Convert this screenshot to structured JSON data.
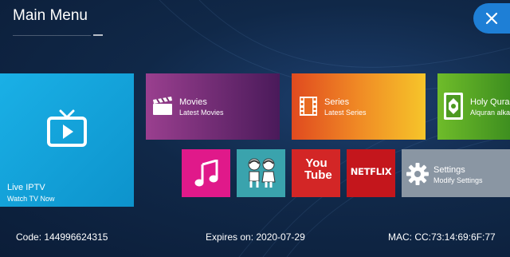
{
  "header": {
    "title": "Main Menu"
  },
  "tiles": {
    "live": {
      "title": "Live IPTV",
      "subtitle": "Watch TV Now"
    },
    "movies": {
      "title": "Movies",
      "subtitle": "Latest Movies"
    },
    "series": {
      "title": "Series",
      "subtitle": "Latest Series"
    },
    "quran": {
      "title": "Holy Quran",
      "subtitle": "Alquran alkarim"
    },
    "youtube": {
      "title": "You Tube"
    },
    "netflix": {
      "title": "NETFLIX"
    },
    "settings": {
      "title": "Settings",
      "subtitle": "Modify Settings"
    }
  },
  "footer": {
    "code": "Code: 144996624315",
    "expires": "Expires on: 2020-07-29",
    "mac": "MAC: CC:73:14:69:6F:77"
  },
  "icons": [
    "close-icon",
    "tv-play-icon",
    "clapperboard-icon",
    "film-strip-icon",
    "quran-book-icon",
    "music-note-icon",
    "kids-icon",
    "youtube-icon",
    "netflix-logo",
    "gear-icon"
  ],
  "colors": {
    "live": "#1ab0e6",
    "movies": "#9a3f8f",
    "series": "#f08a25",
    "quran": "#6fbc2a",
    "music": "#e0198a",
    "kids": "#3aa3ad",
    "youtube": "#d32626",
    "netflix": "#c4161c",
    "settings": "#8a96a3",
    "close": "#1e7fd6"
  }
}
